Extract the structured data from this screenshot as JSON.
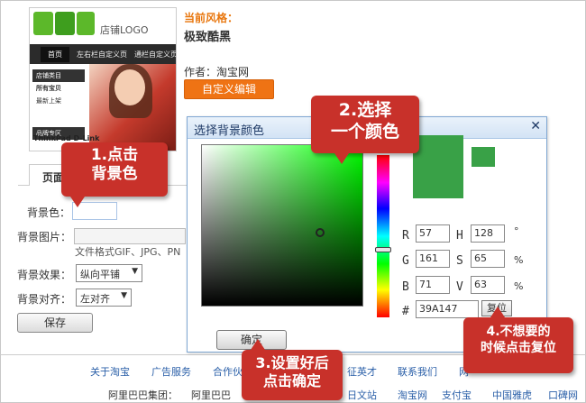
{
  "theme": {
    "logo_text": "店铺LOGO",
    "nav_items": [
      "首页",
      "左右栏自定义页",
      "通栏自定义页"
    ],
    "sidebar": [
      "店铺类目",
      "所有宝贝",
      "最新上架",
      "品牌专区"
    ],
    "brand_text": "ThinkPad  D-Link",
    "current_style_label": "当前风格：",
    "current_style_name": "极致酷黑",
    "author": "作者：淘宝网",
    "customize_button": "自定义编辑"
  },
  "form": {
    "tab_label": "页面",
    "bg_color_label": "背景色：",
    "bg_image_label": "背景图片：",
    "format_note": "文件格式GIF、JPG、PN",
    "bg_effect_label": "背景效果：",
    "bg_effect_value": "纵向平铺",
    "bg_align_label": "背景对齐：",
    "bg_align_value": "左对齐",
    "save_button": "保存"
  },
  "dialog": {
    "title": "选择背景颜色",
    "close_icon": "close-icon",
    "r_label": "R",
    "r_value": "57",
    "g_label": "G",
    "g_value": "161",
    "b_label": "B",
    "b_value": "71",
    "h_label": "H",
    "h_value": "128",
    "h_unit": "°",
    "s_label": "S",
    "s_value": "65",
    "s_unit": "%",
    "v_label": "V",
    "v_value": "63",
    "v_unit": "%",
    "hex_label": "#",
    "hex_value": "39A147",
    "reset_button": "复位",
    "ok_button": "确定",
    "preview_color": "#39A147"
  },
  "callouts": {
    "c1": [
      "1.点击",
      "背景色"
    ],
    "c2": [
      "2.选择",
      "一个颜色"
    ],
    "c3": [
      "3.设置好后",
      "点击确定"
    ],
    "c4": [
      "4.不想要的",
      "时候点击复位"
    ]
  },
  "footer": {
    "row1": [
      "关于淘宝",
      "广告服务",
      "合作伙",
      "征英才",
      "联系我们",
      "网"
    ],
    "row2": [
      "阿里巴巴集团：",
      "阿里巴巴",
      "日文站",
      "淘宝网",
      "支付宝",
      "中国雅虎",
      "口碑网"
    ]
  }
}
